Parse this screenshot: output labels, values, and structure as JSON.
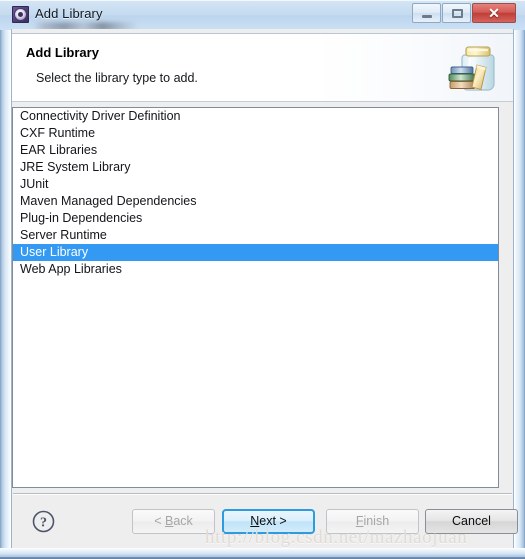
{
  "window": {
    "title": "Add Library",
    "icon": "eclipse-wizard-icon",
    "controls": {
      "minimize_label": "",
      "maximize_label": "",
      "close_label": "✕"
    }
  },
  "header": {
    "title": "Add Library",
    "subtitle": "Select the library type to add.",
    "icon": "jar-with-books-icon"
  },
  "library_list": {
    "selected_index": 8,
    "items": [
      "Connectivity Driver Definition",
      "CXF Runtime",
      "EAR Libraries",
      "JRE System Library",
      "JUnit",
      "Maven Managed Dependencies",
      "Plug-in Dependencies",
      "Server Runtime",
      "User Library",
      "Web App Libraries"
    ]
  },
  "buttons": {
    "help_label": "?",
    "back": {
      "prefix": "< ",
      "mnemonic": "B",
      "rest": "ack",
      "enabled": false
    },
    "next": {
      "prefix": "",
      "mnemonic": "N",
      "rest": "ext >",
      "enabled": true,
      "default": true
    },
    "finish": {
      "prefix": "",
      "mnemonic": "F",
      "rest": "inish",
      "enabled": false
    },
    "cancel": {
      "prefix": "",
      "mnemonic": "",
      "rest": "Cancel",
      "enabled": true
    }
  },
  "watermark": {
    "text": "http://blog.csdn.net/mazhaojuan"
  },
  "colors": {
    "selection": "#3399f3",
    "default_button_border": "#2e9ae0",
    "dialog_bg": "#efeeee",
    "titlebar": "#c5dbf0"
  }
}
